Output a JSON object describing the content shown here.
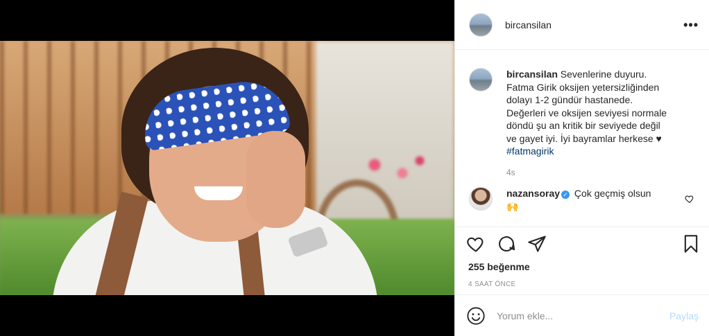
{
  "post": {
    "username": "bircansilan",
    "more_label": "•••"
  },
  "caption": {
    "username": "bircansilan",
    "text": " Sevenlerine duyuru. Fatma Girik oksijen yetersizliğinden dolayı 1-2 gündür hastanede. Değerleri ve oksijen seviyesi normale döndü şu an kritik bir seviyede değil ve gayet iyi. İyi bayramlar herkese ♥ ",
    "hashtag": "#fatmagirik",
    "time": "4s"
  },
  "comment": {
    "username": "nazansoray",
    "verified_mark": "✓",
    "text": " Çok geçmiş olsun",
    "emoji": "🙌"
  },
  "actions": {
    "likes": "255 beğenme",
    "date": "4 SAAT ÖNCE"
  },
  "composer": {
    "placeholder": "Yorum ekle...",
    "post_label": "Paylaş",
    "emoji_icon": "smiley-icon"
  },
  "colors": {
    "link": "#00376b",
    "verified": "#3897f0",
    "post_disabled": "#b3dbff",
    "muted": "#8e8e8e"
  }
}
